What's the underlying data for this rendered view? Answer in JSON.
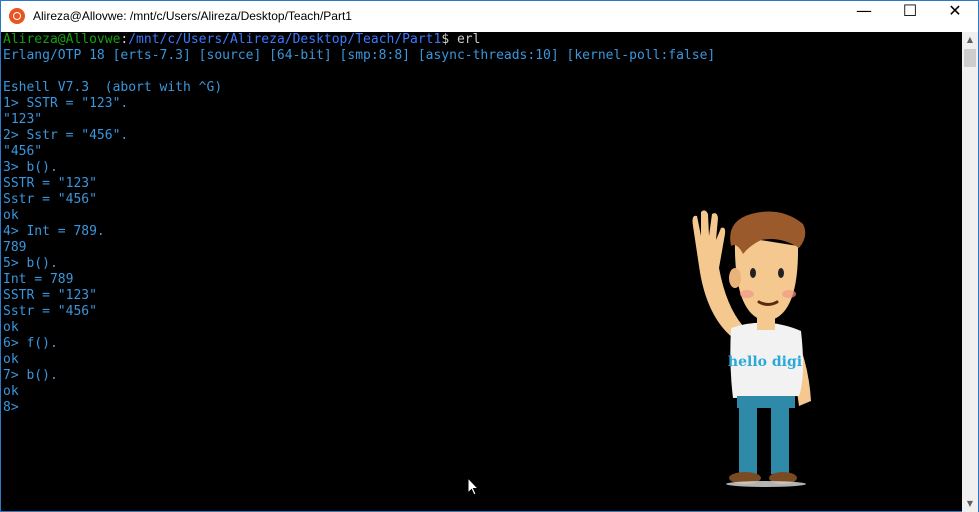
{
  "window": {
    "title": "Alireza@Allovwe: /mnt/c/Users/Alireza/Desktop/Teach/Part1",
    "app_icon": "ubuntu-icon",
    "minimize_glyph": "—",
    "maximize_glyph": "☐",
    "close_glyph": "✕"
  },
  "prompt": {
    "user": "Alireza@Allovwe",
    "separator": ":",
    "path": "/mnt/c/Users/Alireza/Desktop/Teach/Part1",
    "suffix": "$ erl"
  },
  "output_lines": [
    "Erlang/OTP 18 [erts-7.3] [source] [64-bit] [smp:8:8] [async-threads:10] [kernel-poll:false]",
    "",
    "Eshell V7.3  (abort with ^G)",
    "1> SSTR = \"123\".",
    "\"123\"",
    "2> Sstr = \"456\".",
    "\"456\"",
    "3> b().",
    "SSTR = \"123\"",
    "Sstr = \"456\"",
    "ok",
    "4> Int = 789.",
    "789",
    "5> b().",
    "Int = 789",
    "SSTR = \"123\"",
    "Sstr = \"456\"",
    "ok",
    "6> f().",
    "ok",
    "7> b().",
    "ok",
    "8>"
  ],
  "mascot": {
    "shirt_text": "hello digi"
  },
  "colors": {
    "prompt_user": "#13a10e",
    "prompt_path": "#3b78ff",
    "output_text": "#3a96dd",
    "background": "#000000",
    "shirt_text": "#2aa8d8"
  }
}
